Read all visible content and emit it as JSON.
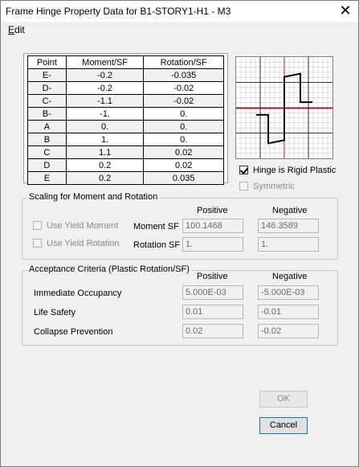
{
  "window": {
    "title": "Frame Hinge Property Data for B1-STORY1-H1 - M3"
  },
  "menu": {
    "edit_first": "E",
    "edit_rest": "dit"
  },
  "table": {
    "headers": [
      "Point",
      "Moment/SF",
      "Rotation/SF"
    ],
    "rows": [
      {
        "point": "E-",
        "moment": "-0.2",
        "rotation": "-0.035"
      },
      {
        "point": "D-",
        "moment": "-0.2",
        "rotation": "-0.02"
      },
      {
        "point": "C-",
        "moment": "-1.1",
        "rotation": "-0.02"
      },
      {
        "point": "B-",
        "moment": "-1.",
        "rotation": "0."
      },
      {
        "point": "A",
        "moment": "0.",
        "rotation": "0."
      },
      {
        "point": "B",
        "moment": "1.",
        "rotation": "0."
      },
      {
        "point": "C",
        "moment": "1.1",
        "rotation": "0.02"
      },
      {
        "point": "D",
        "moment": "0.2",
        "rotation": "0.02"
      },
      {
        "point": "E",
        "moment": "0.2",
        "rotation": "0.035"
      }
    ]
  },
  "options": {
    "rigid_plastic": {
      "label": "Hinge is Rigid Plastic",
      "checked": true
    },
    "symmetric": {
      "label": "Symmetric",
      "checked": false
    }
  },
  "scaling": {
    "title": "Scaling for Moment and Rotation",
    "positive": "Positive",
    "negative": "Negative",
    "use_yield_moment": "Use Yield Moment",
    "use_yield_rotation": "Use Yield Rotation",
    "moment_sf_label": "Moment SF",
    "rotation_sf_label": "Rotation SF",
    "moment_sf_pos": "100.1468",
    "moment_sf_neg": "146.3589",
    "rotation_sf_pos": "1.",
    "rotation_sf_neg": "1."
  },
  "acceptance": {
    "title": "Acceptance Criteria (Plastic Rotation/SF)",
    "positive": "Positive",
    "negative": "Negative",
    "io_label": "Immediate Occupancy",
    "ls_label": "Life Safety",
    "cp_label": "Collapse Prevention",
    "io_pos": "5.000E-03",
    "io_neg": "-5.000E-03",
    "ls_pos": "0.01",
    "ls_neg": "-0.01",
    "cp_pos": "0.02",
    "cp_neg": "-0.02"
  },
  "buttons": {
    "ok": "OK",
    "cancel": "Cancel"
  },
  "colors": {
    "curve": "#000000",
    "axis": "#ff0000",
    "grid_major": "#000000",
    "grid_minor": "#c0c0c0"
  }
}
